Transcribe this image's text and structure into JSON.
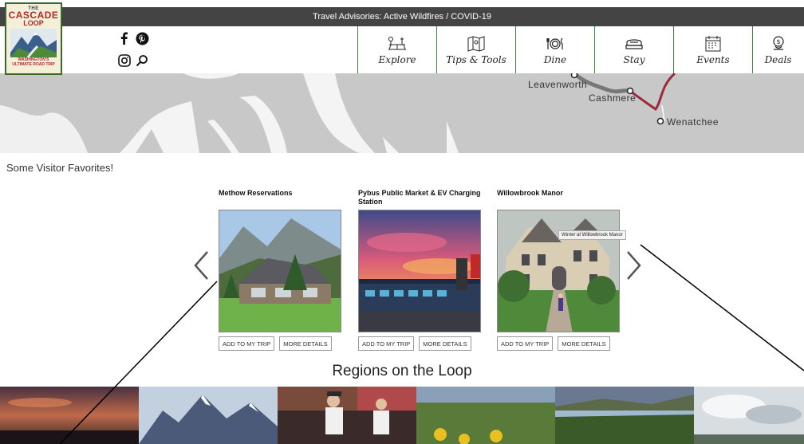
{
  "topbar": {
    "text": "Travel Advisories: Active Wildfires / COVID-19"
  },
  "logo": {
    "line1": "THE",
    "line2": "CASCADE",
    "line3": "LOOP",
    "line4": "WASHINGTON'S",
    "line5": "ULTIMATE ROAD TRIP"
  },
  "social": {
    "icons": [
      "facebook-icon",
      "pinterest-icon",
      "instagram-icon",
      "search-icon"
    ]
  },
  "nav": [
    {
      "label": "Explore",
      "icon": "picnic-table-icon"
    },
    {
      "label": "Tips & Tools",
      "icon": "map-icon"
    },
    {
      "label": "Dine",
      "icon": "dining-icon"
    },
    {
      "label": "Stay",
      "icon": "bed-icon"
    },
    {
      "label": "Events",
      "icon": "calendar-icon"
    },
    {
      "label": "Deals",
      "icon": "coin-pin-icon"
    }
  ],
  "map": {
    "cities": [
      "Leavenworth",
      "Cashmere",
      "Wenatchee"
    ]
  },
  "favorites": {
    "title": "Some Visitor Favorites!",
    "cards": [
      {
        "title": "Methow Reservations",
        "add": "ADD TO MY TRIP",
        "details": "MORE DETAILS"
      },
      {
        "title": "Pybus Public Market & EV Charging Station",
        "add": "ADD TO MY TRIP",
        "details": "MORE DETAILS"
      },
      {
        "title": "Willowbrook Manor",
        "add": "ADD TO MY TRIP",
        "details": "MORE DETAILS",
        "caption": "Winter at Willowbrook Manor"
      }
    ]
  },
  "regions": {
    "title": "Regions on the Loop"
  },
  "colors": {
    "nav_border": "#3d8a3d",
    "topbar": "#444444",
    "map_bg": "#c8c8c8",
    "route_red": "#9a2a3a"
  }
}
